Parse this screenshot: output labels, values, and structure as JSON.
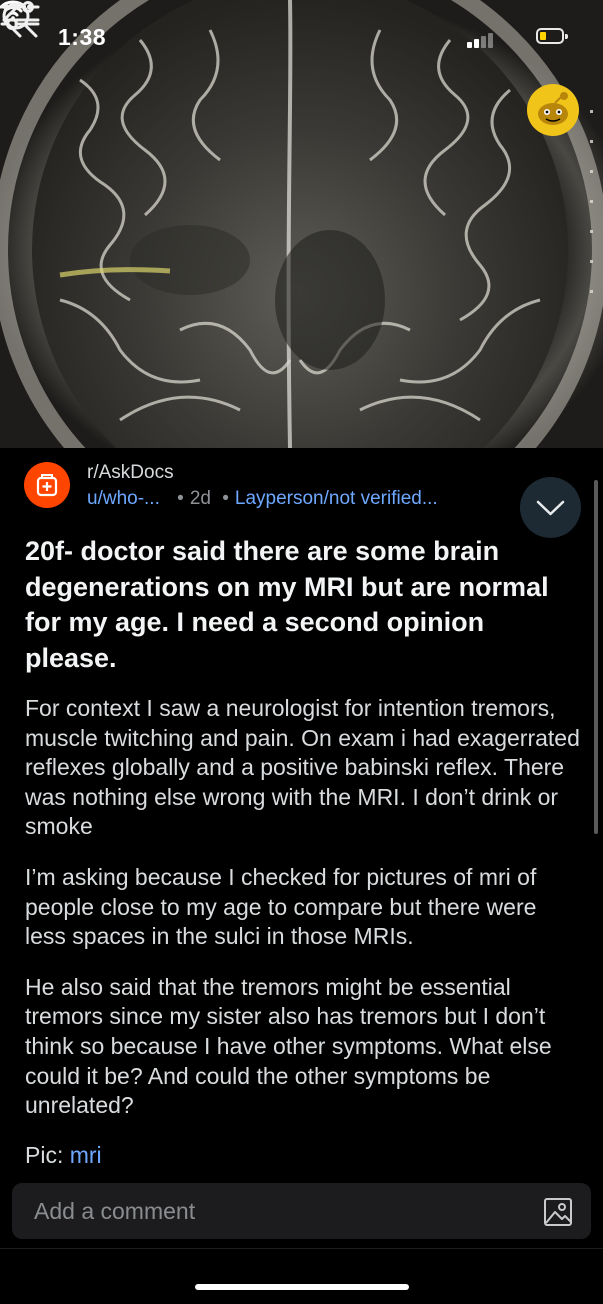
{
  "status_bar": {
    "time": "1:38"
  },
  "header": {
    "icons": [
      "back-arrow-icon",
      "search-icon",
      "filter-icon",
      "more-icon",
      "reddit-avatar"
    ]
  },
  "post": {
    "subreddit": "r/AskDocs",
    "author": "u/who-...",
    "separator": "•",
    "age": "2d",
    "flair": "Layperson/not verified...",
    "title": "20f- doctor said there are some brain degenerations on my MRI but are normal for my age. I need a second opinion please.",
    "body": [
      "For context I saw a neurologist for intention tremors, muscle twitching and pain. On exam i had exagerrated reflexes globally and a positive babinski reflex. There was nothing else wrong with the MRI. I don’t drink or smoke",
      "I’m asking because I checked for pictures of mri of people close to my age to compare but there were less spaces in the sulci in those MRIs.",
      "He also said that the tremors might be essential tremors since my sister also has tremors but I don’t think so because I have other symptoms. What else could it be? And could the other symptoms be unrelated?"
    ],
    "pic_label": "Pic:",
    "pic_link": "mri"
  },
  "comment": {
    "placeholder": "Add a comment"
  },
  "colors": {
    "accent_link": "#6ea8ff",
    "subreddit_icon": "#ff4500",
    "avatar": "#f0c419",
    "background": "#000000"
  }
}
